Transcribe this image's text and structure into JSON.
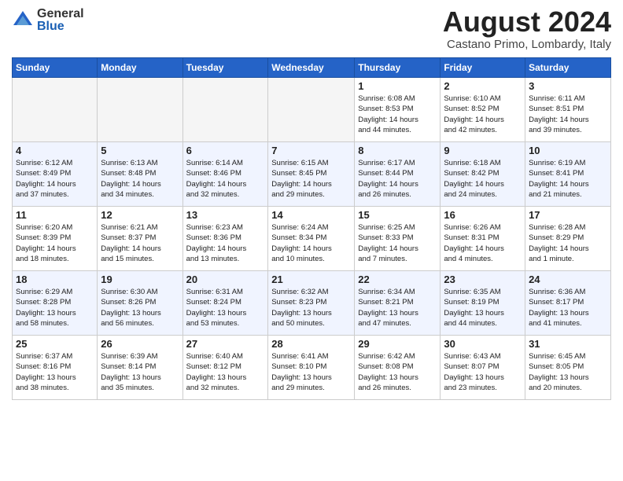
{
  "header": {
    "logo_general": "General",
    "logo_blue": "Blue",
    "month_year": "August 2024",
    "location": "Castano Primo, Lombardy, Italy"
  },
  "days_of_week": [
    "Sunday",
    "Monday",
    "Tuesday",
    "Wednesday",
    "Thursday",
    "Friday",
    "Saturday"
  ],
  "weeks": [
    [
      {
        "day": "",
        "info": ""
      },
      {
        "day": "",
        "info": ""
      },
      {
        "day": "",
        "info": ""
      },
      {
        "day": "",
        "info": ""
      },
      {
        "day": "1",
        "info": "Sunrise: 6:08 AM\nSunset: 8:53 PM\nDaylight: 14 hours\nand 44 minutes."
      },
      {
        "day": "2",
        "info": "Sunrise: 6:10 AM\nSunset: 8:52 PM\nDaylight: 14 hours\nand 42 minutes."
      },
      {
        "day": "3",
        "info": "Sunrise: 6:11 AM\nSunset: 8:51 PM\nDaylight: 14 hours\nand 39 minutes."
      }
    ],
    [
      {
        "day": "4",
        "info": "Sunrise: 6:12 AM\nSunset: 8:49 PM\nDaylight: 14 hours\nand 37 minutes."
      },
      {
        "day": "5",
        "info": "Sunrise: 6:13 AM\nSunset: 8:48 PM\nDaylight: 14 hours\nand 34 minutes."
      },
      {
        "day": "6",
        "info": "Sunrise: 6:14 AM\nSunset: 8:46 PM\nDaylight: 14 hours\nand 32 minutes."
      },
      {
        "day": "7",
        "info": "Sunrise: 6:15 AM\nSunset: 8:45 PM\nDaylight: 14 hours\nand 29 minutes."
      },
      {
        "day": "8",
        "info": "Sunrise: 6:17 AM\nSunset: 8:44 PM\nDaylight: 14 hours\nand 26 minutes."
      },
      {
        "day": "9",
        "info": "Sunrise: 6:18 AM\nSunset: 8:42 PM\nDaylight: 14 hours\nand 24 minutes."
      },
      {
        "day": "10",
        "info": "Sunrise: 6:19 AM\nSunset: 8:41 PM\nDaylight: 14 hours\nand 21 minutes."
      }
    ],
    [
      {
        "day": "11",
        "info": "Sunrise: 6:20 AM\nSunset: 8:39 PM\nDaylight: 14 hours\nand 18 minutes."
      },
      {
        "day": "12",
        "info": "Sunrise: 6:21 AM\nSunset: 8:37 PM\nDaylight: 14 hours\nand 15 minutes."
      },
      {
        "day": "13",
        "info": "Sunrise: 6:23 AM\nSunset: 8:36 PM\nDaylight: 14 hours\nand 13 minutes."
      },
      {
        "day": "14",
        "info": "Sunrise: 6:24 AM\nSunset: 8:34 PM\nDaylight: 14 hours\nand 10 minutes."
      },
      {
        "day": "15",
        "info": "Sunrise: 6:25 AM\nSunset: 8:33 PM\nDaylight: 14 hours\nand 7 minutes."
      },
      {
        "day": "16",
        "info": "Sunrise: 6:26 AM\nSunset: 8:31 PM\nDaylight: 14 hours\nand 4 minutes."
      },
      {
        "day": "17",
        "info": "Sunrise: 6:28 AM\nSunset: 8:29 PM\nDaylight: 14 hours\nand 1 minute."
      }
    ],
    [
      {
        "day": "18",
        "info": "Sunrise: 6:29 AM\nSunset: 8:28 PM\nDaylight: 13 hours\nand 58 minutes."
      },
      {
        "day": "19",
        "info": "Sunrise: 6:30 AM\nSunset: 8:26 PM\nDaylight: 13 hours\nand 56 minutes."
      },
      {
        "day": "20",
        "info": "Sunrise: 6:31 AM\nSunset: 8:24 PM\nDaylight: 13 hours\nand 53 minutes."
      },
      {
        "day": "21",
        "info": "Sunrise: 6:32 AM\nSunset: 8:23 PM\nDaylight: 13 hours\nand 50 minutes."
      },
      {
        "day": "22",
        "info": "Sunrise: 6:34 AM\nSunset: 8:21 PM\nDaylight: 13 hours\nand 47 minutes."
      },
      {
        "day": "23",
        "info": "Sunrise: 6:35 AM\nSunset: 8:19 PM\nDaylight: 13 hours\nand 44 minutes."
      },
      {
        "day": "24",
        "info": "Sunrise: 6:36 AM\nSunset: 8:17 PM\nDaylight: 13 hours\nand 41 minutes."
      }
    ],
    [
      {
        "day": "25",
        "info": "Sunrise: 6:37 AM\nSunset: 8:16 PM\nDaylight: 13 hours\nand 38 minutes."
      },
      {
        "day": "26",
        "info": "Sunrise: 6:39 AM\nSunset: 8:14 PM\nDaylight: 13 hours\nand 35 minutes."
      },
      {
        "day": "27",
        "info": "Sunrise: 6:40 AM\nSunset: 8:12 PM\nDaylight: 13 hours\nand 32 minutes."
      },
      {
        "day": "28",
        "info": "Sunrise: 6:41 AM\nSunset: 8:10 PM\nDaylight: 13 hours\nand 29 minutes."
      },
      {
        "day": "29",
        "info": "Sunrise: 6:42 AM\nSunset: 8:08 PM\nDaylight: 13 hours\nand 26 minutes."
      },
      {
        "day": "30",
        "info": "Sunrise: 6:43 AM\nSunset: 8:07 PM\nDaylight: 13 hours\nand 23 minutes."
      },
      {
        "day": "31",
        "info": "Sunrise: 6:45 AM\nSunset: 8:05 PM\nDaylight: 13 hours\nand 20 minutes."
      }
    ]
  ]
}
